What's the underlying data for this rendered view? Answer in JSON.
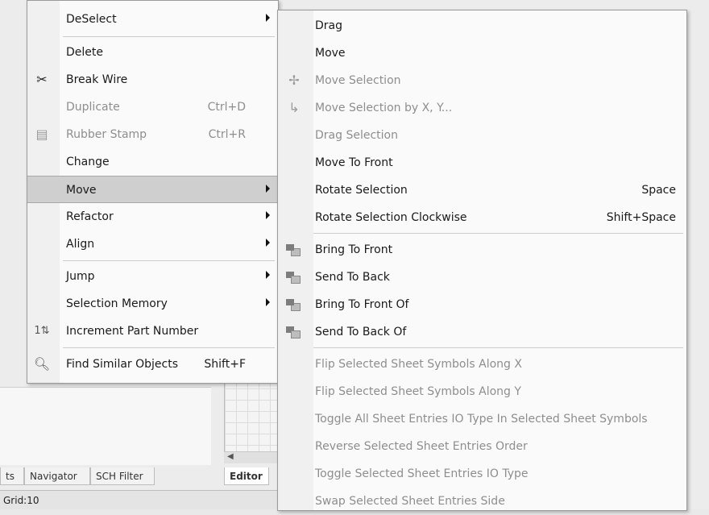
{
  "main_menu": {
    "items": [
      {
        "label": "DeSelect",
        "submenu": true
      },
      {
        "label": "Delete"
      },
      {
        "label": "Break Wire",
        "icon": "scissors-icon"
      },
      {
        "label": "Duplicate",
        "shortcut": "Ctrl+D",
        "disabled": true
      },
      {
        "label": "Rubber Stamp",
        "shortcut": "Ctrl+R",
        "disabled": true,
        "icon": "rubber-stamp-icon"
      },
      {
        "label": "Change"
      },
      {
        "label": "Move",
        "submenu": true,
        "highlighted": true
      },
      {
        "label": "Refactor",
        "submenu": true
      },
      {
        "label": "Align",
        "submenu": true
      },
      {
        "label": "Jump",
        "submenu": true
      },
      {
        "label": "Selection Memory",
        "submenu": true
      },
      {
        "label": "Increment Part Number",
        "icon": "increment-icon"
      },
      {
        "label": "Find Similar Objects",
        "shortcut": "Shift+F",
        "icon": "magnifier-icon"
      }
    ]
  },
  "move_submenu": {
    "items": [
      {
        "label": "Drag"
      },
      {
        "label": "Move"
      },
      {
        "label": "Move Selection",
        "disabled": true,
        "icon": "move-cross-icon"
      },
      {
        "label": "Move Selection by X, Y...",
        "disabled": true,
        "icon": "move-xy-icon"
      },
      {
        "label": "Drag Selection",
        "disabled": true
      },
      {
        "label": "Move To Front"
      },
      {
        "label": "Rotate Selection",
        "shortcut": "Space"
      },
      {
        "label": "Rotate Selection Clockwise",
        "shortcut": "Shift+Space"
      },
      {
        "label": "Bring To Front",
        "icon": "bring-to-front-icon"
      },
      {
        "label": "Send To Back",
        "icon": "send-to-back-icon"
      },
      {
        "label": "Bring To Front Of",
        "icon": "bring-to-front-of-icon"
      },
      {
        "label": "Send To Back Of",
        "icon": "send-to-back-of-icon"
      },
      {
        "label": "Flip Selected Sheet Symbols Along X",
        "disabled": true
      },
      {
        "label": "Flip Selected Sheet Symbols Along Y",
        "disabled": true
      },
      {
        "label": "Toggle All Sheet Entries IO Type In Selected Sheet Symbols",
        "disabled": true
      },
      {
        "label": "Reverse Selected Sheet Entries Order",
        "disabled": true
      },
      {
        "label": "Toggle Selected Sheet Entries  IO Type",
        "disabled": true
      },
      {
        "label": "Swap Selected Sheet Entries Side",
        "disabled": true
      }
    ]
  },
  "bottom_tabs": [
    "ts",
    "Navigator",
    "SCH Filter"
  ],
  "editor_tab": "Editor",
  "status_text": "Grid:10"
}
